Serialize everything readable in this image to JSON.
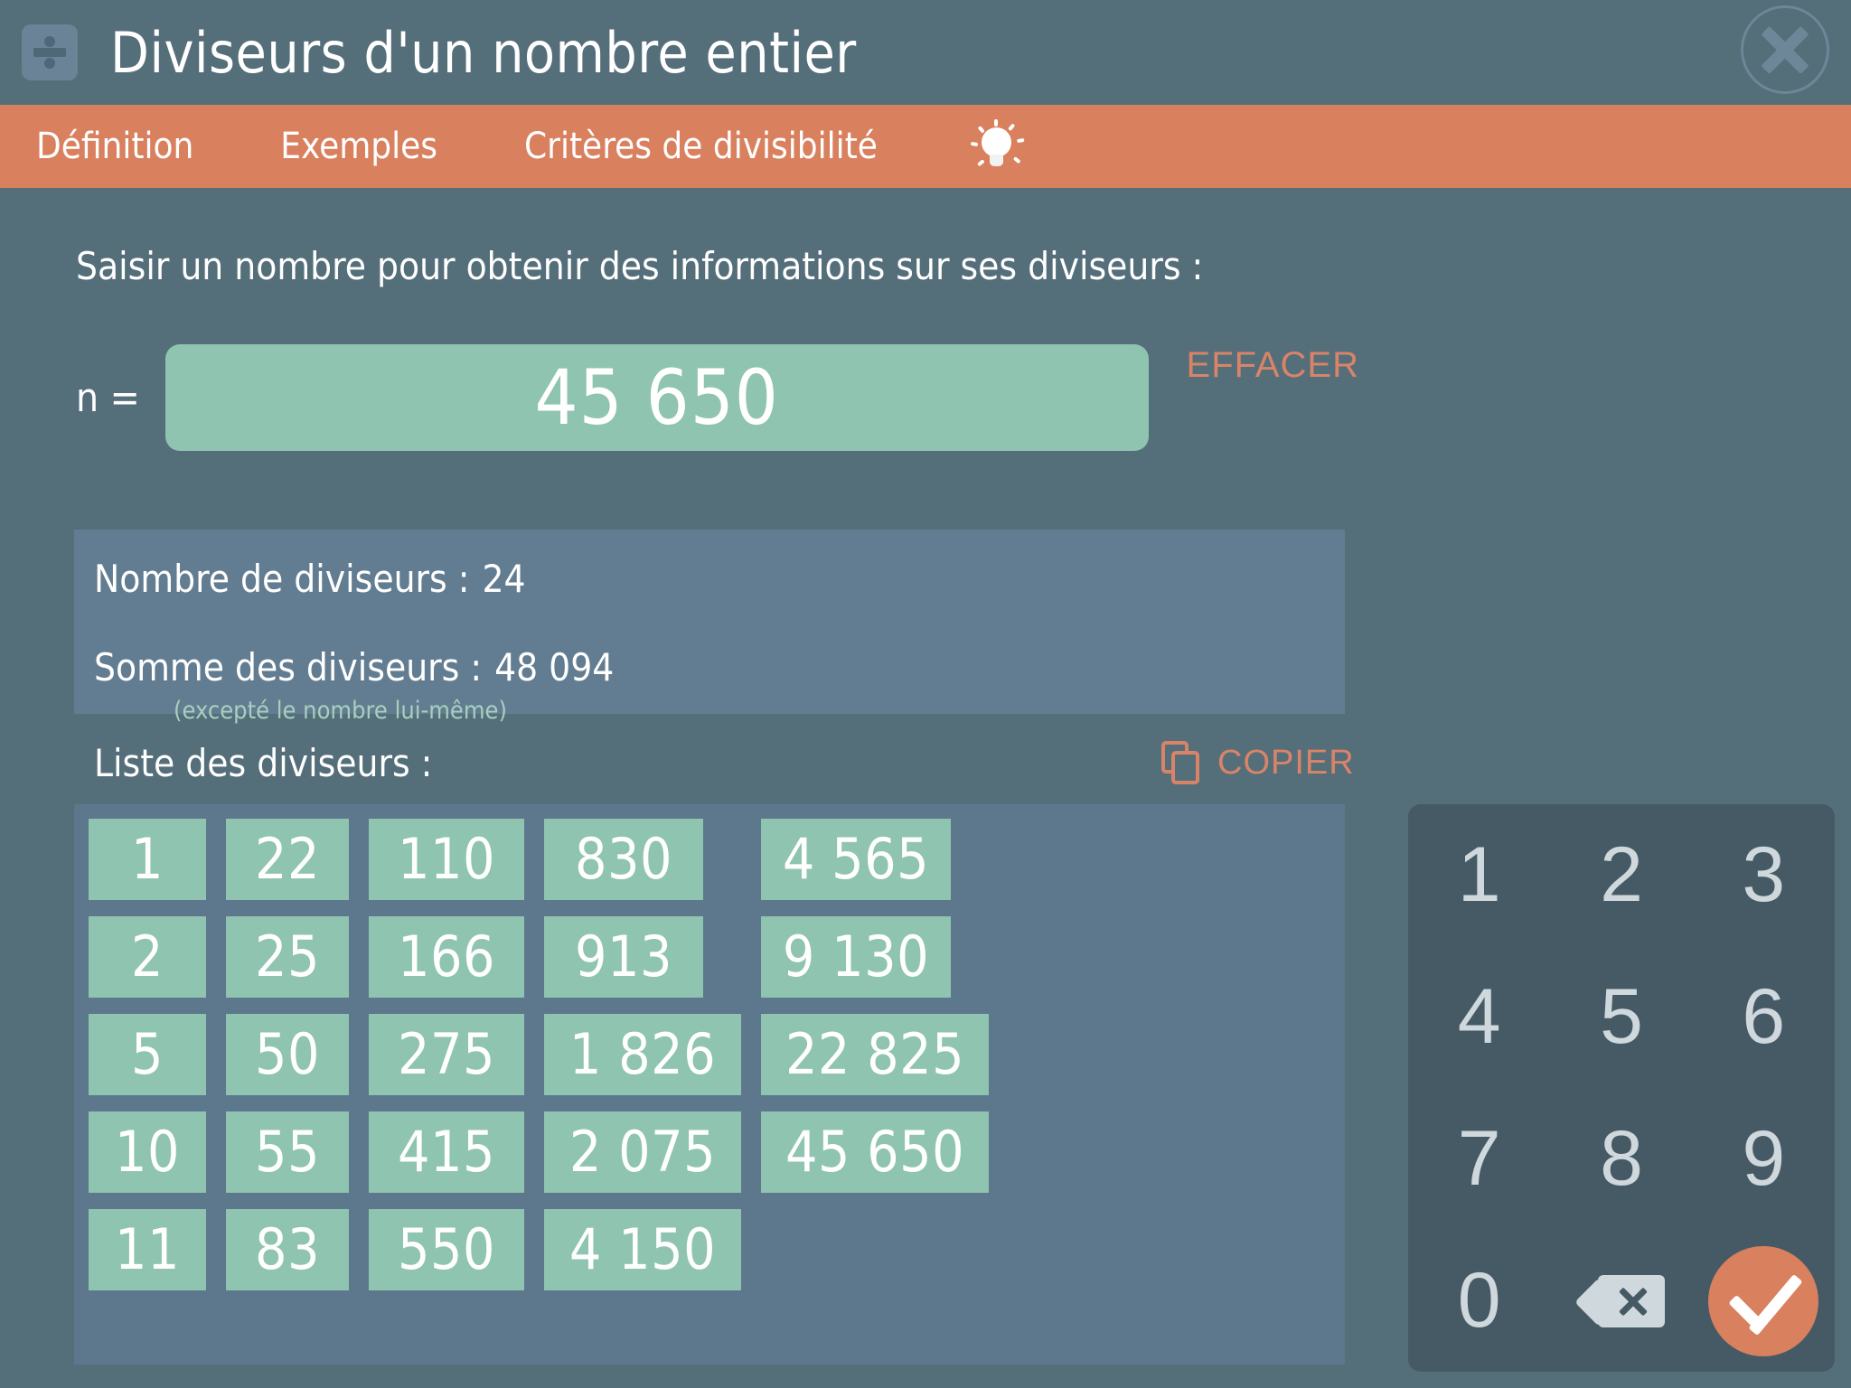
{
  "window": {
    "title": "Diviseurs d'un nombre entier",
    "app_icon": "division-icon",
    "close_icon": "close-icon"
  },
  "nav": {
    "items": [
      {
        "label": "Définition",
        "name": "tab-definition"
      },
      {
        "label": "Exemples",
        "name": "tab-exemples"
      },
      {
        "label": "Critères de divisibilité",
        "name": "tab-criteres-divisibilite"
      }
    ],
    "hint_icon": "lightbulb-icon"
  },
  "main": {
    "prompt": "Saisir un nombre pour obtenir des informations sur ses diviseurs :",
    "n_label": "n =",
    "n_value": "45 650",
    "clear_label": "EFFACER",
    "info": {
      "count_label": "Nombre de diviseurs :",
      "count_value": "24",
      "sum_label": "Somme des diviseurs  :",
      "sum_value": "48 094",
      "sum_note": "(excepté le nombre lui-même)"
    },
    "list_label": "Liste des diviseurs  :",
    "copy_label": "COPIER",
    "copy_icon": "copy-icon",
    "divisor_columns": [
      [
        "1",
        "2",
        "5",
        "10",
        "11"
      ],
      [
        "22",
        "25",
        "50",
        "55",
        "83"
      ],
      [
        "110",
        "166",
        "275",
        "415",
        "550"
      ],
      [
        "830",
        "913",
        "1 826",
        "2 075",
        "4 150"
      ],
      [
        "4 565",
        "9 130",
        "22 825",
        "45 650"
      ]
    ]
  },
  "keypad": {
    "keys": [
      "1",
      "2",
      "3",
      "4",
      "5",
      "6",
      "7",
      "8",
      "9",
      "0"
    ],
    "backspace_icon": "backspace-icon",
    "confirm_icon": "check-icon"
  },
  "colors": {
    "background": "#546e7a",
    "accent_orange": "#d9805f",
    "field_green": "#8ec4b0",
    "panel_blue": "#627d91",
    "grid_panel": "#5d788c",
    "keypad_bg": "#455a64"
  }
}
